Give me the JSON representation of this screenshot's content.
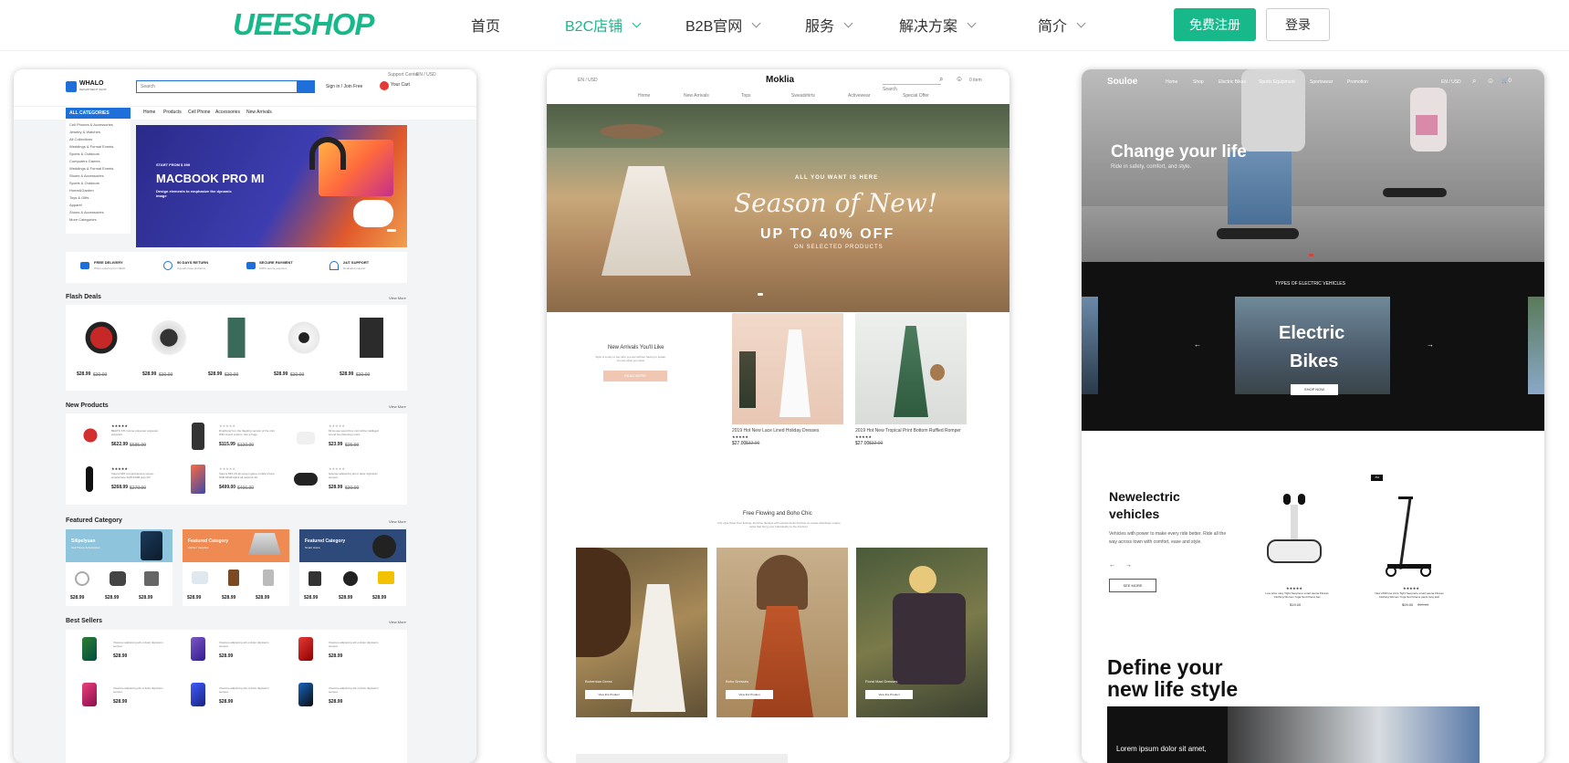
{
  "header": {
    "logo": "UEESHOP",
    "nav": [
      {
        "label": "首页",
        "dropdown": false
      },
      {
        "label": "B2C店铺",
        "dropdown": true,
        "active": true
      },
      {
        "label": "B2B官网",
        "dropdown": true
      },
      {
        "label": "服务",
        "dropdown": true
      },
      {
        "label": "解决方案",
        "dropdown": true
      },
      {
        "label": "简介",
        "dropdown": true
      }
    ],
    "register": "免费注册",
    "login": "登录",
    "accent": "#17b88a"
  },
  "card1": {
    "top_links": [
      "Support Center",
      "EN / USD"
    ],
    "logo": "WHALO",
    "logo_sub": "DEPARTMENT SHOP",
    "search_placeholder": "Search",
    "signin": "Sign in / Join Free",
    "cart": "Your Cart",
    "menu": [
      "Home",
      "Products",
      "Cell Phone",
      "Accessories",
      "New Arrivals"
    ],
    "categories_title": "ALL CATEGORIES",
    "categories": [
      "Cell Phones & Accessories",
      "Jewelry & Watches",
      "All Collections",
      "Weddings & Formal Events",
      "Sports & Outdoors",
      "Computers Games",
      "Weddings & Formal Events",
      "Shoes & Accessories",
      "Sports & Outdoors",
      "Home&Garden",
      "Toys & Gifts",
      "Apparel",
      "Shoes & Accessories",
      "More Categories"
    ],
    "banner": {
      "kicker": "START FROM $ 399",
      "title": "MACBOOK PRO MI",
      "text": "Design elements to emphasize the dynamic image"
    },
    "features": [
      {
        "title": "FREE DELIVERY",
        "text": "When ordering from $100"
      },
      {
        "title": "90 DAYS RETURN",
        "text": "If goods have problems"
      },
      {
        "title": "SECURE PAYMENT",
        "text": "100% secure payment"
      },
      {
        "title": "24/7 SUPPORT",
        "text": "Dedicated support"
      }
    ],
    "flash_title": "Flash Deals",
    "view_more": "View More",
    "flash_prices": [
      {
        "p": "$28.99",
        "o": "$30.99"
      },
      {
        "p": "$28.99",
        "o": "$30.99"
      },
      {
        "p": "$28.99",
        "o": "$30.99"
      },
      {
        "p": "$28.99",
        "o": "$30.99"
      },
      {
        "p": "$28.99",
        "o": "$30.99"
      }
    ],
    "new_title": "New Products",
    "new_products": [
      {
        "stars": "★★★★★",
        "desc": "BEATS STU Home polyester polyester polyester",
        "p": "$622.99",
        "o": "$685.99"
      },
      {
        "stars": "★★★★★",
        "desc": "DingDongYun, the flagship version of the mini WiFi sound system, has a huge",
        "p": "$115.99",
        "o": "$120.99"
      },
      {
        "stars": "★★★★★",
        "desc": "Mi House sound box mini white intelligent sound box listening music",
        "p": "$23.99",
        "o": "$25.99"
      },
      {
        "stars": "★★★★★",
        "desc": "Xiaomi MIX comprehensive screen smartphone 4GB 64GB gray full",
        "p": "$268.99",
        "o": "$279.99"
      },
      {
        "stars": "★★★★★",
        "desc": "Xiaomi MIX 2S all screen game mobile phone 6GB 64GB black all network 4G",
        "p": "$499.00",
        "o": "$496.99"
      },
      {
        "stars": "★★★★★",
        "desc": "Hisense adipiscing elit ut dolor dignissim semper.",
        "p": "$28.99",
        "o": "$30.99"
      }
    ],
    "featured_title": "Featured Category",
    "featured": [
      {
        "title": "Silipelyuan",
        "sub": "Cell Phone Accessories",
        "color": "#8ec5dc"
      },
      {
        "title": "Featured Category",
        "sub": "Kitchen Supplies",
        "color": "#ef8a52"
      },
      {
        "title": "Featured Category",
        "sub": "Smart Home",
        "color": "#2e4a7a"
      }
    ],
    "featured_prices": [
      "$28.99",
      "$28.99",
      "$28.99",
      "$28.99",
      "$28.99",
      "$28.99",
      "$28.99",
      "$28.99",
      "$28.99",
      "$28.99",
      "$28.99",
      "$28.99"
    ],
    "featured_old": "$30.99",
    "best_title": "Best Sellers",
    "best": [
      {
        "desc": "Vivamus adipiscing elit ut dolor dignissim semper.",
        "p": "$28.99",
        "o": "$30.99"
      },
      {
        "desc": "Vivamus adipiscing elit ut dolor dignissim semper.",
        "p": "$28.99",
        "o": "$30.99"
      },
      {
        "desc": "Vivamus adipiscing elit ut dolor dignissim semper.",
        "p": "$28.99",
        "o": "$30.99"
      },
      {
        "desc": "Vivamus adipiscing elit ut dolor dignissim semper.",
        "p": "$28.99",
        "o": "$30.99"
      },
      {
        "desc": "Vivamus adipiscing elit ut dolor dignissim semper.",
        "p": "$28.99",
        "o": "$30.99"
      },
      {
        "desc": "Vivamus adipiscing elit ut dolor dignissim semper.",
        "p": "$28.99",
        "o": "$30.99"
      }
    ]
  },
  "card2": {
    "lang": "EN / USD",
    "logo": "Moklia",
    "search": "Search",
    "cart": "0 item",
    "menu": [
      "Home",
      "New Arrivals",
      "Tops",
      "Sweatshirts",
      "Activewear",
      "Special Offer"
    ],
    "hero_kicker": "ALL YOU WANT IS HERE",
    "hero_script": "Season of New!",
    "hero_title": "UP TO 40% OFF",
    "hero_sub": "ON SELECTED PRODUCTS",
    "arrivals_title": "New Arrivals You'll Like",
    "arrivals_text": "Style is a way to say who you are without having to speak. You are what you wear.",
    "read_more": "READ MORE",
    "products": [
      {
        "name": "2019 Hot New Lace Lined Holiday Dresses",
        "stars": "★★★★★",
        "p": "$27.00",
        "o": "$32.00"
      },
      {
        "name": "2019 Hot New Tropical Print Bottom Ruffled Romper",
        "stars": "★★★★★",
        "p": "$27.00",
        "o": "$32.00"
      }
    ],
    "boho_title": "Free Flowing and Boho Chic",
    "boho_text": "Our style flows from flowing, feminine designs with spirited looks that feel so create absolutely unique looks that bring your individuality to the forefront.",
    "looks": [
      {
        "label": "Bohemian Dress",
        "btn": "View this Product"
      },
      {
        "label": "Boho Dresses",
        "btn": "View this Product"
      },
      {
        "label": "Floral Maxi Dresses",
        "btn": "View this Product"
      }
    ]
  },
  "card3": {
    "logo": "Souloe",
    "menu": [
      "Home",
      "Shop",
      "Electric Bikes",
      "Sports Equipment",
      "Sportswear",
      "Promotion"
    ],
    "lang": "EN / USD",
    "cart": "0",
    "hero_title": "Change your life",
    "hero_sub": "Ride in safety, comfort, and style.",
    "types_title": "TYPES OF ELECTRIC VEHICLES",
    "slide_title_1": "Electric",
    "slide_title_2": "Bikes",
    "shop_now": "SHOP NOW",
    "new_title_1": "Newelectric",
    "new_title_2": "vehicles",
    "new_text": "Vehicles with power to make every ride better. Ride all the way across town with comfort, ease and style.",
    "see_more": "SEE MORE",
    "badge": "-5%",
    "items": [
      {
        "stars": "★★★★★",
        "name": "Low price navy Tight Neoprene smart sauna Fitness Clothing Women Yoga Set Fitness Set",
        "price": "$19.00"
      },
      {
        "stars": "★★★★★",
        "name": "New 2019 low price Tight Neoprene smart sauna Fitness Clothing Women Yoga Set Fitness pants long skirt",
        "price": "$09.00",
        "old": "$19.00"
      }
    ],
    "define_1": "Define your",
    "define_2": "new life style",
    "lorem": "Lorem ipsum dolor sit amet,"
  }
}
